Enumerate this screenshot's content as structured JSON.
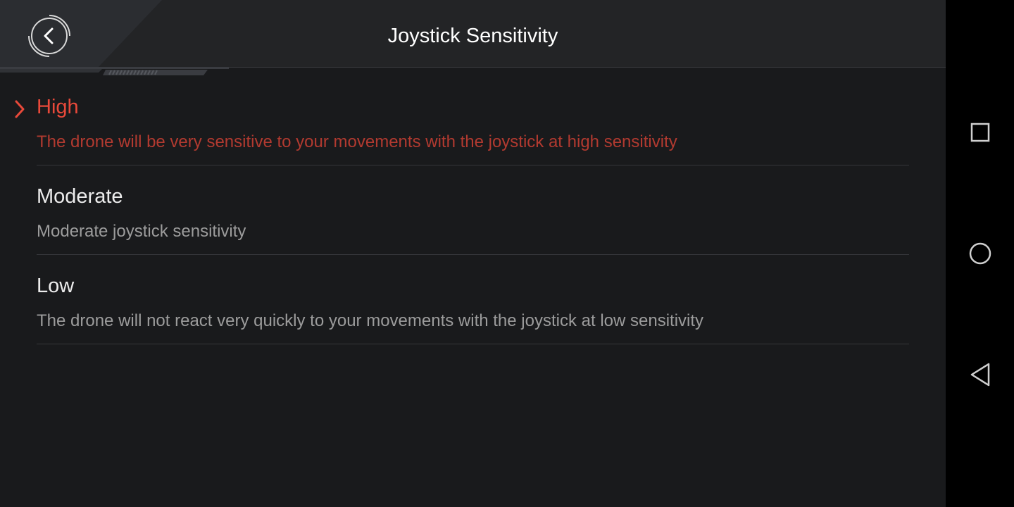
{
  "header": {
    "title": "Joystick Sensitivity",
    "back_icon": "chevron-left-icon"
  },
  "options": [
    {
      "key": "high",
      "title": "High",
      "description": "The drone will be very sensitive to your movements with the joystick at high sensitivity",
      "selected": true
    },
    {
      "key": "moderate",
      "title": "Moderate",
      "description": "Moderate joystick sensitivity",
      "selected": false
    },
    {
      "key": "low",
      "title": "Low",
      "description": "The drone will not react very quickly to your movements with the joystick at low sensitivity",
      "selected": false
    }
  ],
  "navbar": {
    "recents_icon": "square-icon",
    "home_icon": "circle-icon",
    "back_icon": "triangle-back-icon"
  },
  "colors": {
    "accent": "#e8493a",
    "accent_dim": "#b23a30",
    "background": "#191a1c",
    "header": "#232426",
    "text": "#ececec",
    "text_secondary": "#9c9c9c"
  }
}
